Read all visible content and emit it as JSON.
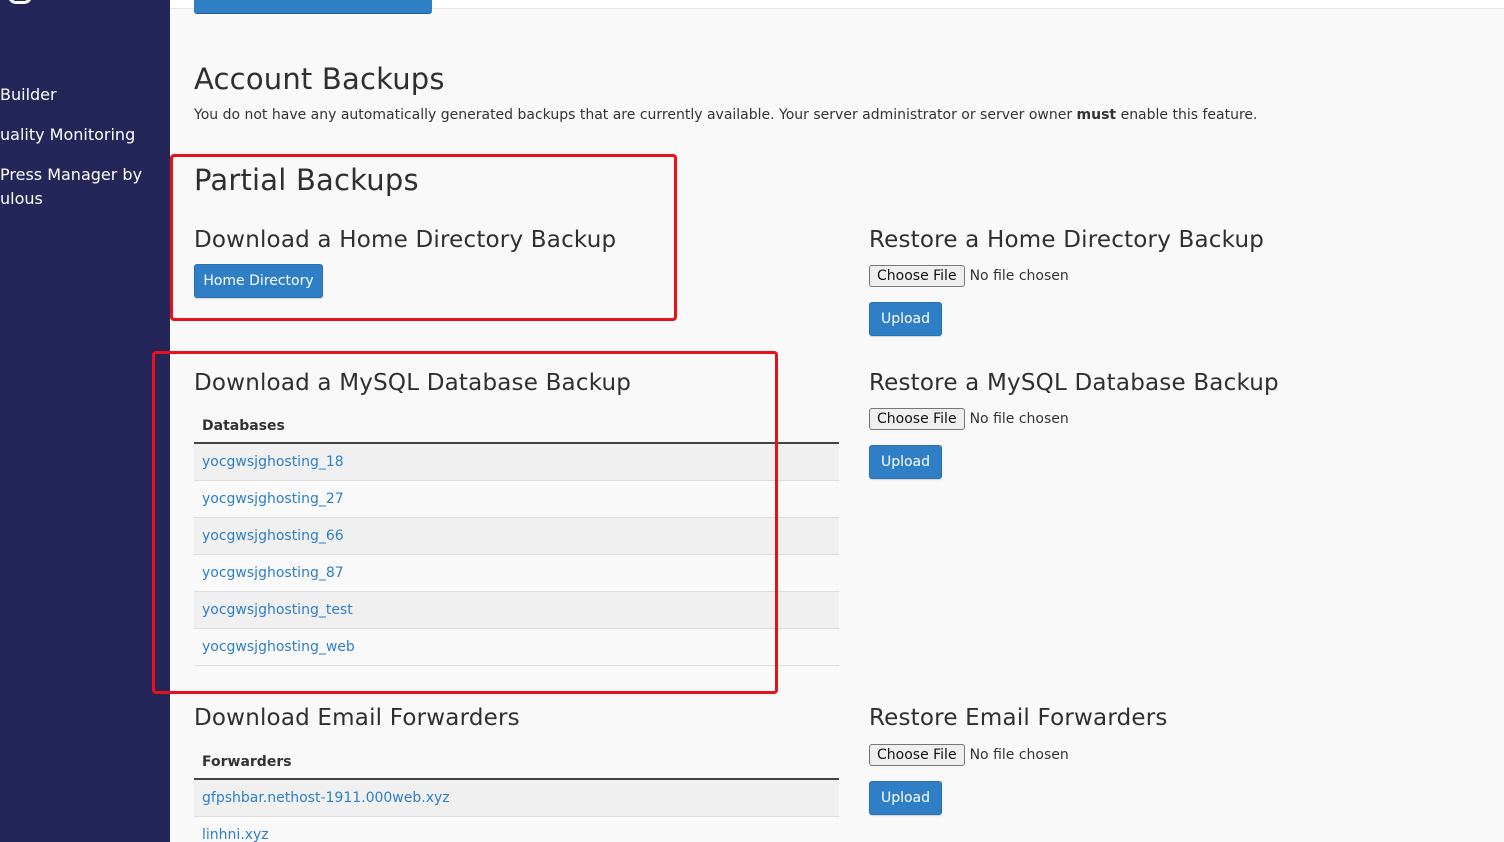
{
  "sidebar": {
    "items": [
      {
        "label": " Builder"
      },
      {
        "label": "uality Monitoring"
      },
      {
        "label": "Press Manager by"
      },
      {
        "label": "ulous"
      }
    ]
  },
  "account_backups": {
    "title": "Account Backups",
    "note_before": "You do not have any automatically generated backups that are currently available. Your server administrator or server owner ",
    "note_bold": "must",
    "note_after": " enable this feature."
  },
  "partial_backups": {
    "title": "Partial Backups"
  },
  "home_download": {
    "title": "Download a Home Directory Backup",
    "button": "Home Directory"
  },
  "home_restore": {
    "title": "Restore a Home Directory Backup",
    "choose": "Choose File",
    "status": "No file chosen",
    "upload": "Upload"
  },
  "mysql_download": {
    "title": "Download a MySQL Database Backup",
    "column": "Databases",
    "rows": [
      "yocgwsjghosting_18",
      "yocgwsjghosting_27",
      "yocgwsjghosting_66",
      "yocgwsjghosting_87",
      "yocgwsjghosting_test",
      "yocgwsjghosting_web"
    ]
  },
  "mysql_restore": {
    "title": "Restore a MySQL Database Backup",
    "choose": "Choose File",
    "status": "No file chosen",
    "upload": "Upload"
  },
  "email_download": {
    "title": "Download Email Forwarders",
    "column": "Forwarders",
    "rows": [
      "gfpshbar.nethost-1911.000web.xyz",
      "linhni.xyz"
    ]
  },
  "email_restore": {
    "title": "Restore Email Forwarders",
    "choose": "Choose File",
    "status": "No file chosen",
    "upload": "Upload"
  },
  "colors": {
    "sidebar": "#24265a",
    "accent": "#2f7fc7",
    "highlight": "#e8101a"
  }
}
